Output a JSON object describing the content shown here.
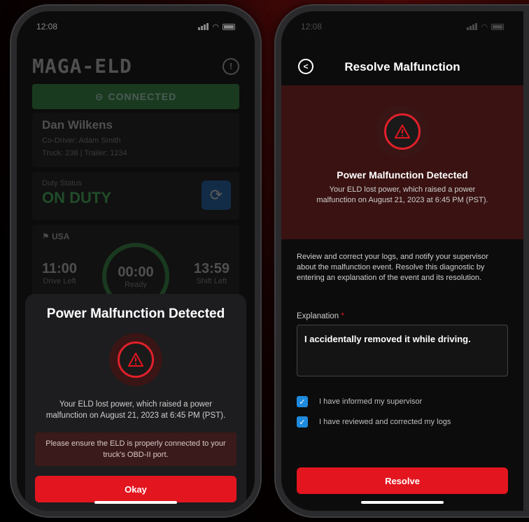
{
  "left": {
    "status_time": "12:08",
    "brand": "MAGA-ELD",
    "connection_status": "CONNECTED",
    "driver": {
      "name": "Dan Wilkens",
      "co_driver": "Co-Driver: Adam Smith",
      "vehicle": "Truck: 238  |  Trailer: 1234"
    },
    "duty": {
      "label": "Duty Status",
      "value": "ON DUTY"
    },
    "clock": {
      "country": "USA",
      "drive_left_value": "11:00",
      "drive_left_label": "Drive Left",
      "ring_value": "00:00",
      "ring_label": "Ready",
      "shift_left_value": "13:59",
      "shift_left_label": "Shift Left"
    },
    "modal": {
      "title": "Power Malfunction Detected",
      "message": "Your ELD lost power, which raised a power malfunction on August 21, 2023 at 6:45 PM (PST).",
      "note": "Please ensure the ELD is properly connected to your truck's OBD-II port.",
      "button": "Okay"
    }
  },
  "right": {
    "status_time": "12:08",
    "title": "Resolve Malfunction",
    "banner": {
      "title": "Power Malfunction Detected",
      "message": "Your ELD lost power, which raised a power malfunction on August 21, 2023 at 6:45 PM (PST)."
    },
    "instructions": "Review and correct your logs, and notify your supervisor about the malfunction event. Resolve this diagnostic by entering an explanation of the event and its resolution.",
    "explanation_label": "Explanation",
    "explanation_required": "*",
    "explanation_value": "I accidentally removed it while driving.",
    "checks": [
      {
        "label": "I have informed my supervisor",
        "checked": true
      },
      {
        "label": "I have reviewed and corrected my logs",
        "checked": true
      }
    ],
    "button": "Resolve"
  },
  "colors": {
    "accent_red": "#e3151e",
    "connected_green": "#3a9a4a",
    "on_duty_green": "#4bd26a",
    "checkbox_blue": "#1e8bde"
  },
  "icons": {
    "warning": "warning-triangle-icon",
    "info": "info-icon",
    "back": "back-arrow-icon",
    "sync": "sync-icon",
    "link": "link-icon",
    "flag": "us-flag-icon"
  }
}
